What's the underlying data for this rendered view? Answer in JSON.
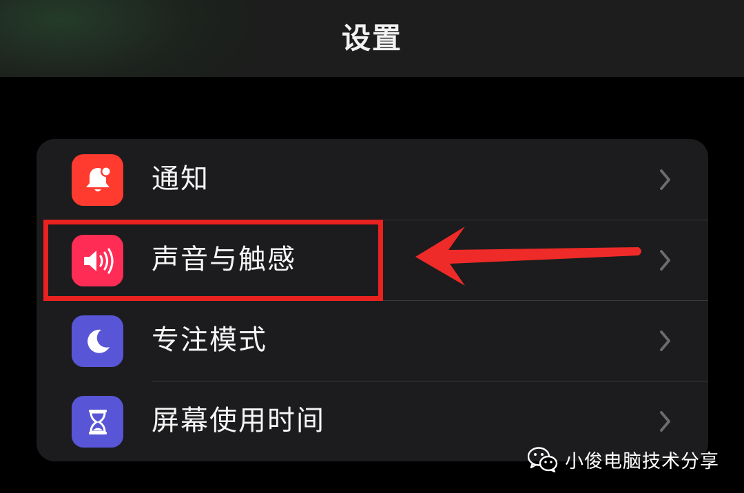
{
  "navbar": {
    "title": "设置",
    "background": "#1c1d1c"
  },
  "settings": {
    "items": [
      {
        "label": "通知",
        "icon": "bell-badge-icon",
        "icon_color": "#ff3b30"
      },
      {
        "label": "声音与触感",
        "icon": "speaker-wave-icon",
        "icon_color": "#ff2d55"
      },
      {
        "label": "专注模式",
        "icon": "moon-icon",
        "icon_color": "#5856d6"
      },
      {
        "label": "屏幕使用时间",
        "icon": "hourglass-icon",
        "icon_color": "#5856d6"
      }
    ]
  },
  "annotation": {
    "highlighted_item": "声音与触感",
    "color": "#e8221f"
  },
  "watermark": {
    "text": "小俊电脑技术分享",
    "icon": "wechat-icon"
  }
}
